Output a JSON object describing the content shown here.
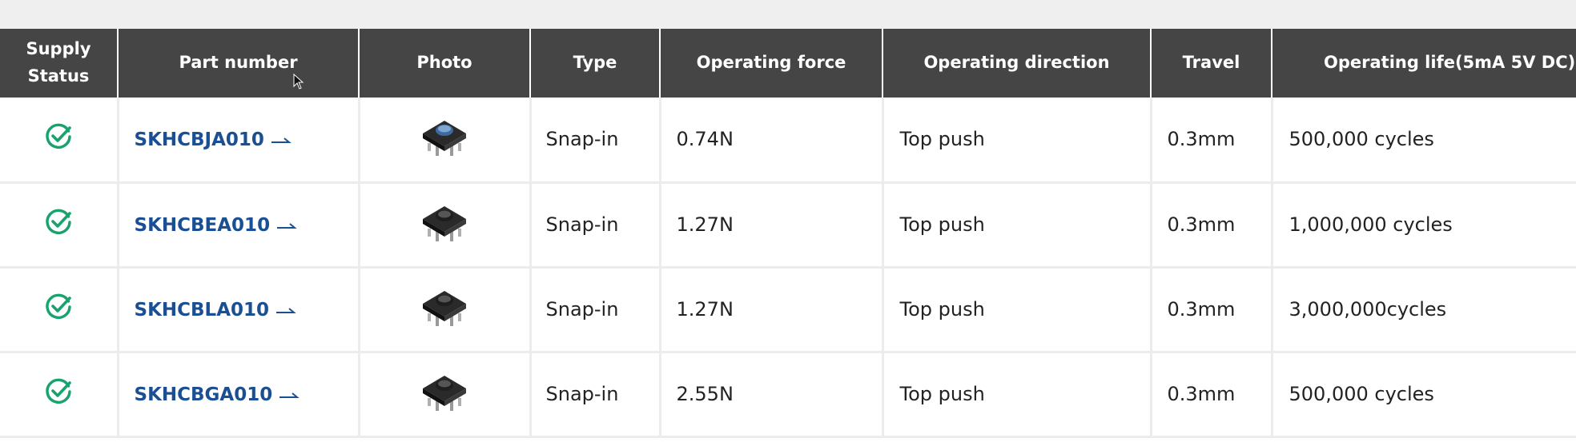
{
  "table": {
    "headers": {
      "supply_line1": "Supply",
      "supply_line2": "Status",
      "part_number": "Part number",
      "photo": "Photo",
      "type": "Type",
      "operating_force": "Operating force",
      "operating_direction": "Operating direction",
      "travel": "Travel",
      "operating_life": "Operating life(5mA 5V DC)"
    },
    "rows": [
      {
        "status_icon": "check-circle-icon",
        "part_number": "SKHCBJA010",
        "photo_variant": "blue-actuator",
        "type": "Snap-in",
        "operating_force": "0.74N",
        "operating_direction": "Top push",
        "travel": "0.3mm",
        "operating_life": "500,000 cycles"
      },
      {
        "status_icon": "check-circle-icon",
        "part_number": "SKHCBEA010",
        "photo_variant": "black-actuator",
        "type": "Snap-in",
        "operating_force": "1.27N",
        "operating_direction": "Top push",
        "travel": "0.3mm",
        "operating_life": "1,000,000 cycles"
      },
      {
        "status_icon": "check-circle-icon",
        "part_number": "SKHCBLA010",
        "photo_variant": "black-actuator",
        "type": "Snap-in",
        "operating_force": "1.27N",
        "operating_direction": "Top push",
        "travel": "0.3mm",
        "operating_life": "3,000,000cycles"
      },
      {
        "status_icon": "check-circle-icon",
        "part_number": "SKHCBGA010",
        "photo_variant": "black-actuator",
        "type": "Snap-in",
        "operating_force": "2.55N",
        "operating_direction": "Top push",
        "travel": "0.3mm",
        "operating_life": "500,000 cycles"
      }
    ]
  },
  "colors": {
    "header_bg": "#454545",
    "link": "#1a4f94",
    "status_green": "#18a36e"
  }
}
